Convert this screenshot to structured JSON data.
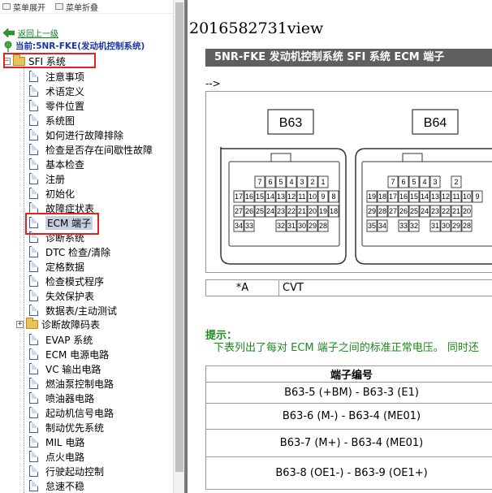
{
  "toolbar": {
    "expand_label": "菜单展开",
    "collapse_label": "菜单折叠"
  },
  "nav": {
    "back_label": "返回上一级",
    "current_label": "当前:5NR-FKE(发动机控制系统)"
  },
  "tree": {
    "root_label": "SFI 系统",
    "items": [
      "注意事项",
      "术语定义",
      "零件位置",
      "系统图",
      "如何进行故障排除",
      "检查是否存在间歇性故障",
      "基本检查",
      "注册",
      "初始化",
      "故障症状表",
      "ECM 端子",
      "诊断系统",
      "DTC 检查/清除",
      "定格数据",
      "检查模式程序",
      "失效保护表",
      "数据表/主动测试"
    ],
    "dtc_folder_label": "诊断故障码表",
    "items2": [
      "EVAP 系统",
      "ECM 电源电路",
      "VC 输出电路",
      "燃油泵控制电路",
      "喷油器电路",
      "起动机信号电路",
      "制动优先系统",
      "MIL 电路",
      "点火电路",
      "行驶起动控制",
      "怠速不稳"
    ]
  },
  "content": {
    "doc_title": "2016582731view",
    "banner": "5NR-FKE 发动机控制系统 SFI 系统 ECM 端子",
    "comment_arrow": "-->",
    "connector_b63": "B63",
    "connector_b64": "B64",
    "b63_pins": [
      [
        "7",
        "6",
        "5",
        "4",
        "3",
        "2",
        "1"
      ],
      [
        "17",
        "16",
        "15",
        "14",
        "13",
        "12",
        "11",
        "10",
        "9",
        "8"
      ],
      [
        "27",
        "26",
        "25",
        "24",
        "23",
        "22",
        "21",
        "20",
        "19",
        "18"
      ],
      [
        "34",
        "33",
        "",
        "",
        "32",
        "31",
        "30",
        "29",
        "28"
      ]
    ],
    "b64_pins": [
      [
        "7",
        "6",
        "5",
        "4",
        "3",
        "",
        "2"
      ],
      [
        "19",
        "18",
        "17",
        "16",
        "15",
        "14",
        "13",
        "12",
        "11",
        "10",
        "9"
      ],
      [
        "29",
        "28",
        "27",
        "26",
        "25",
        "24",
        "23",
        "22",
        "21",
        "20"
      ],
      [
        "35",
        "34",
        "",
        "33",
        "32",
        "",
        "31",
        "30",
        "29",
        "28"
      ]
    ],
    "cvt_row": {
      "a": "*A",
      "b": "CVT"
    },
    "hint_label": "提示：",
    "hint_text": "下表列出了每对 ECM 端子之间的标准正常电压。 同时还",
    "table_header": "端子编号",
    "table_rows": [
      "B63-5 (+BM) - B63-3 (E1)",
      "B63-6 (M-) - B63-4 (ME01)",
      "B63-7 (M+) - B63-4 (ME01)",
      "B63-8 (OE1-) - B63-9 (OE1+)"
    ]
  },
  "colors": {
    "banner_bg": "#5f5f5f",
    "hint_green": "#1c8a1c",
    "highlight_red": "#e32020",
    "current_blue": "#1a35a8"
  }
}
